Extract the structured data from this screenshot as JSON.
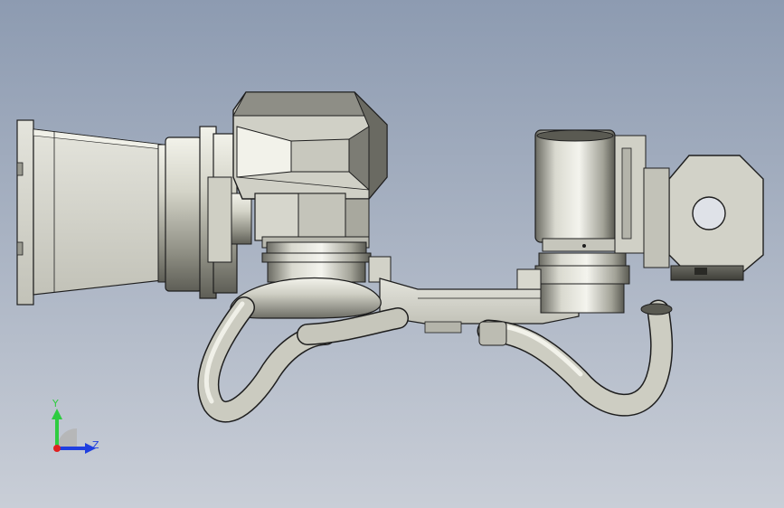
{
  "viewport": {
    "background_top": "#8d9bb1",
    "background_bottom": "#c9ced7"
  },
  "triad": {
    "y_label": "Y",
    "z_label": "Z",
    "y_color": "#2ecc40",
    "z_color": "#1f3fe0",
    "x_color": "#e02020"
  },
  "model": {
    "metal_light": "#e6e6dc",
    "metal_mid": "#b9b9ad",
    "metal_dark": "#55554d",
    "edge": "#1e1e1e"
  }
}
